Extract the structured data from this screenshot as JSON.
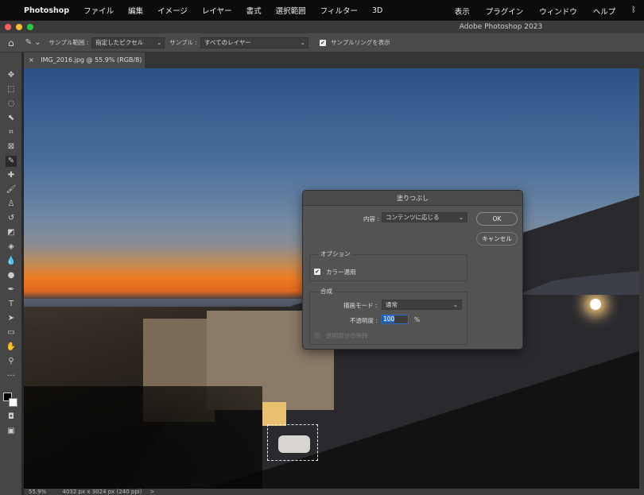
{
  "menubar": {
    "app": "Photoshop",
    "items": [
      "ファイル",
      "編集",
      "イメージ",
      "レイヤー",
      "書式",
      "選択範囲",
      "フィルター",
      "3D"
    ],
    "right_items": [
      "表示",
      "プラグイン",
      "ウィンドウ",
      "ヘルプ"
    ]
  },
  "window": {
    "title": "Adobe Photoshop 2023"
  },
  "options": {
    "sample_range_label": "サンプル範囲 :",
    "sample_range_value": "指定したピクセル",
    "sample_label": "サンプル :",
    "sample_value": "すべてのレイヤー",
    "show_ring_label": "サンプルリングを表示",
    "show_ring_checked": true
  },
  "document": {
    "tab_label": "IMG_2016.jpg @ 55.9% (RGB/8) *",
    "close": "×"
  },
  "status": {
    "zoom": "55.9%",
    "dimensions": "4032 px x 3024 px (240 ppi)",
    "arrow": ">"
  },
  "dialog": {
    "title": "塗りつぶし",
    "contents_label": "内容 :",
    "contents_value": "コンテンツに応じる",
    "ok": "OK",
    "cancel": "キャンセル",
    "options_group": "オプション",
    "color_adapt_label": "カラー適用",
    "color_adapt_checked": true,
    "blend_group": "合成",
    "mode_label": "描画モード :",
    "mode_value": "通常",
    "opacity_label": "不透明度 :",
    "opacity_value": "100",
    "opacity_unit": "%",
    "preserve_label": "透明部分の保持",
    "preserve_checked": false
  },
  "colors": {
    "accent": "#2a6fd0",
    "dialog_bg": "#535353"
  }
}
